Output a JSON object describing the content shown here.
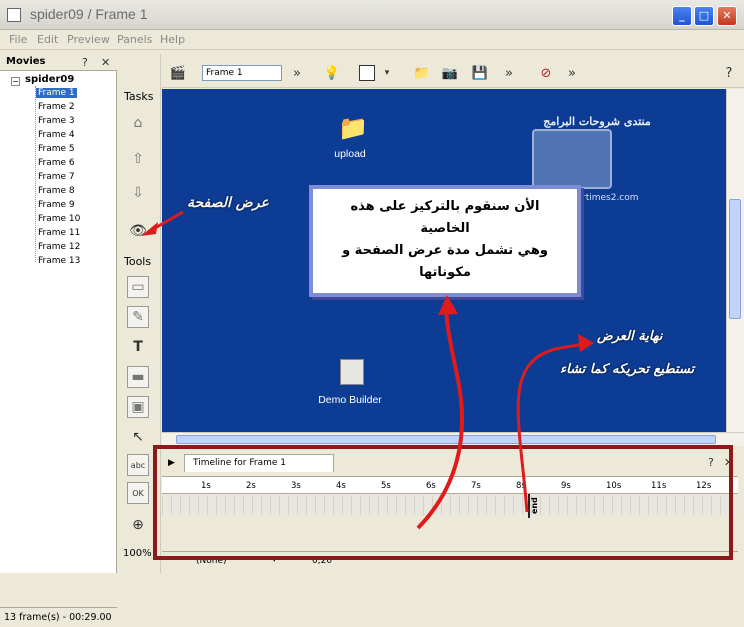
{
  "window": {
    "title": "spider09 / Frame 1"
  },
  "menu": [
    "File",
    "Edit",
    "Preview",
    "Panels",
    "Help"
  ],
  "movies_panel": {
    "title": "Movies",
    "root": "spider09",
    "frames": [
      "Frame 1",
      "Frame 2",
      "Frame 3",
      "Frame 4",
      "Frame 5",
      "Frame 6",
      "Frame 7",
      "Frame 8",
      "Frame 9",
      "Frame 10",
      "Frame 11",
      "Frame 12",
      "Frame 13"
    ],
    "selected": "Frame 1",
    "status": "13 frame(s) - 00:29.00"
  },
  "tasks": {
    "label": "Tasks"
  },
  "tools": {
    "label": "Tools",
    "zoom": "100%"
  },
  "toolbar": {
    "frame_value": "Frame 1"
  },
  "desktop": {
    "icons": [
      "upload",
      "Demo Builder"
    ],
    "watermark_url": "rtimes2.com",
    "watermark_title": "منتدى شروحات البرامج"
  },
  "callout": {
    "line1": "الأن سنقوم بالتركيز على هذه",
    "line2": "الخاصية",
    "line3": "وهي تشمل مدة عرض الصفحة و",
    "line4": "مكوناتها"
  },
  "annotations": {
    "page_display": "عرض الصفحة",
    "end_display": "نهاية العرض",
    "move_hint": "تستطيع تحريكه كما تشاء"
  },
  "timeline": {
    "tab_label": "Timeline for Frame 1",
    "ticks": [
      "1s",
      "2s",
      "3s",
      "4s",
      "5s",
      "6s",
      "7s",
      "8s",
      "9s",
      "10s",
      "11s",
      "12s"
    ],
    "end_marker": "end",
    "bottom_value1": "(None)",
    "bottom_value2": "0,20"
  },
  "colors": {
    "canvas": "#0c3c94",
    "accent_red": "#e01b1b",
    "frame_border": "#8b1a1a"
  }
}
